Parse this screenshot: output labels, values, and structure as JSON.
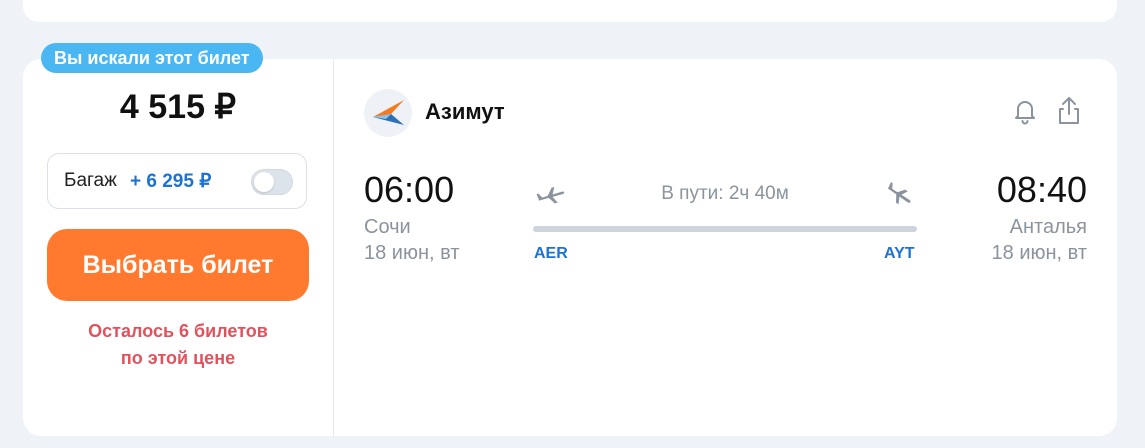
{
  "ticket": {
    "badge": "Вы искали этот билет",
    "price": "4 515 ₽",
    "baggage": {
      "label": "Багаж",
      "price": "+ 6 295 ₽",
      "enabled": false
    },
    "select_button": "Выбрать билет",
    "tickets_left_line1": "Осталось 6 билетов",
    "tickets_left_line2": "по этой цене"
  },
  "flight": {
    "airline": "Азимут",
    "departure": {
      "time": "06:00",
      "city": "Сочи",
      "date": "18 июн, вт",
      "code": "AER"
    },
    "arrival": {
      "time": "08:40",
      "city": "Анталья",
      "date": "18 июн, вт",
      "code": "AYT"
    },
    "duration": "В пути: 2ч 40м"
  },
  "icons": {
    "bell": "bell-icon",
    "share": "share-icon",
    "takeoff": "takeoff-plane-icon",
    "landing": "landing-plane-icon"
  },
  "colors": {
    "accent_orange": "#ff7a2f",
    "badge_blue": "#4ab7f2",
    "link_blue": "#1d72d6",
    "warning_red": "#e2525d"
  }
}
